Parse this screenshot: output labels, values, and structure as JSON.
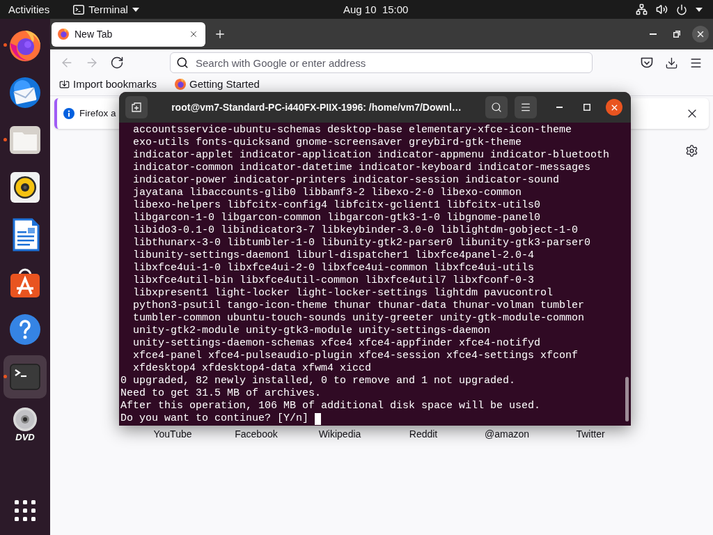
{
  "top_bar": {
    "activities": "Activities",
    "app_menu": "Terminal",
    "clock": "Aug 10  15:00"
  },
  "dock": {
    "items": [
      {
        "kind": "firefox",
        "running": true,
        "selected": false
      },
      {
        "kind": "thunderbird",
        "running": false,
        "selected": false
      },
      {
        "kind": "files",
        "running": true,
        "selected": false
      },
      {
        "kind": "rhythmbox",
        "running": false,
        "selected": false
      },
      {
        "kind": "writer",
        "running": false,
        "selected": false
      },
      {
        "kind": "software",
        "running": false,
        "selected": false
      },
      {
        "kind": "help",
        "running": false,
        "selected": false
      },
      {
        "kind": "terminal",
        "running": true,
        "selected": true
      },
      {
        "kind": "dvd",
        "running": false,
        "selected": false,
        "badge": "DVD"
      }
    ]
  },
  "browser": {
    "tabs": [
      {
        "title": "New Tab",
        "selected": true
      }
    ],
    "nav_buttons": [
      {
        "kind": "back",
        "disabled": true
      },
      {
        "kind": "forward",
        "disabled": true
      },
      {
        "kind": "reload",
        "disabled": false
      }
    ],
    "address_bar": {
      "placeholder": "Search with Google or enter address"
    },
    "bookmarks": [
      {
        "kind": "import",
        "label": "Import bookmarks"
      },
      {
        "kind": "page",
        "label": "Getting Started"
      }
    ],
    "notification": {
      "text": "Firefox a"
    },
    "top_sites": [
      {
        "label": "YouTube"
      },
      {
        "label": "Facebook"
      },
      {
        "label": "Wikipedia"
      },
      {
        "label": "Reddit"
      },
      {
        "label": "@amazon"
      },
      {
        "label": "Twitter"
      }
    ]
  },
  "terminal": {
    "title": "root@vm7-Standard-PC-i440FX-PIIX-1996: /home/vm7/Downl…",
    "lines": [
      {
        "kind": "package",
        "text": "accountsservice-ubuntu-schemas desktop-base elementary-xfce-icon-theme"
      },
      {
        "kind": "package",
        "text": "exo-utils fonts-quicksand gnome-screensaver greybird-gtk-theme"
      },
      {
        "kind": "package",
        "text": "indicator-applet indicator-application indicator-appmenu indicator-bluetooth"
      },
      {
        "kind": "package",
        "text": "indicator-common indicator-datetime indicator-keyboard indicator-messages"
      },
      {
        "kind": "package",
        "text": "indicator-power indicator-printers indicator-session indicator-sound"
      },
      {
        "kind": "package",
        "text": "jayatana libaccounts-glib0 libbamf3-2 libexo-2-0 libexo-common"
      },
      {
        "kind": "package",
        "text": "libexo-helpers libfcitx-config4 libfcitx-gclient1 libfcitx-utils0"
      },
      {
        "kind": "package",
        "text": "libgarcon-1-0 libgarcon-common libgarcon-gtk3-1-0 libgnome-panel0"
      },
      {
        "kind": "package",
        "text": "libido3-0.1-0 libindicator3-7 libkeybinder-3.0-0 liblightdm-gobject-1-0"
      },
      {
        "kind": "package",
        "text": "libthunarx-3-0 libtumbler-1-0 libunity-gtk2-parser0 libunity-gtk3-parser0"
      },
      {
        "kind": "package",
        "text": "libunity-settings-daemon1 liburl-dispatcher1 libxfce4panel-2.0-4"
      },
      {
        "kind": "package",
        "text": "libxfce4ui-1-0 libxfce4ui-2-0 libxfce4ui-common libxfce4ui-utils"
      },
      {
        "kind": "package",
        "text": "libxfce4util-bin libxfce4util-common libxfce4util7 libxfconf-0-3"
      },
      {
        "kind": "package",
        "text": "libxpresent1 light-locker light-locker-settings lightdm pavucontrol"
      },
      {
        "kind": "package",
        "text": "python3-psutil tango-icon-theme thunar thunar-data thunar-volman tumbler"
      },
      {
        "kind": "package",
        "text": "tumbler-common ubuntu-touch-sounds unity-greeter unity-gtk-module-common"
      },
      {
        "kind": "package",
        "text": "unity-gtk2-module unity-gtk3-module unity-settings-daemon"
      },
      {
        "kind": "package",
        "text": "unity-settings-daemon-schemas xfce4 xfce4-appfinder xfce4-notifyd"
      },
      {
        "kind": "package",
        "text": "xfce4-panel xfce4-pulseaudio-plugin xfce4-session xfce4-settings xfconf"
      },
      {
        "kind": "package",
        "text": "xfdesktop4 xfdesktop4-data xfwm4 xiccd"
      },
      {
        "kind": "output",
        "text": "0 upgraded, 82 newly installed, 0 to remove and 1 not upgraded."
      },
      {
        "kind": "output",
        "text": "Need to get 31.5 MB of archives."
      },
      {
        "kind": "output",
        "text": "After this operation, 106 MB of additional disk space will be used."
      },
      {
        "kind": "prompt",
        "text": "Do you want to continue? [Y/n]"
      }
    ]
  }
}
